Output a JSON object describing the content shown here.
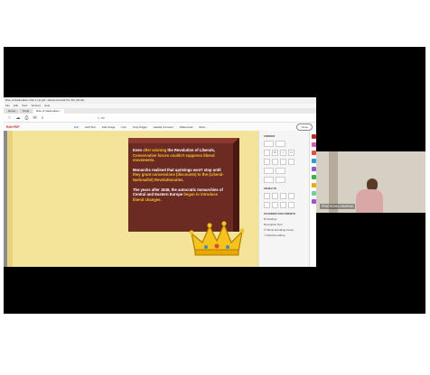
{
  "window": {
    "title": "Rise of Nationalism Part 1 (1).pdf - Adobe Acrobat Pro DC (32-bit)"
  },
  "menubar": [
    "File",
    "Edit",
    "View",
    "Window",
    "Help"
  ],
  "tabs": [
    {
      "label": "Home"
    },
    {
      "label": "Tools"
    },
    {
      "label": "Rise of Nationalism..."
    }
  ],
  "toolbar": {
    "page_display": "1 / 55",
    "zoom": "100%"
  },
  "edit_toolbar": {
    "mode_label": "Edit PDF",
    "tools": [
      "Edit",
      "Add Text",
      "Add Image",
      "Link",
      "Crop Pages",
      "Header & Footer",
      "Watermark",
      "More"
    ],
    "close_label": "Close"
  },
  "slide": {
    "p1_a": "Even ",
    "p1_b": "after winning",
    "p1_c": " the Revolution of Liberals, ",
    "p1_d": "Conservative forces couldn't suppress liberal movements.",
    "p2_a": "Monarchs realised that uprisings won't stop until ",
    "p2_b": "they grant concessions (discounts) to the (Liberal-Nationalist) Revolutionaries.",
    "p3_a": "The years after 1848, the autocratic monarchies of Central and Eastern Europe ",
    "p3_b": "began to introduce liberal changes."
  },
  "format_panel": {
    "format_heading": "FORMAT",
    "objects_heading": "OBJECTS",
    "scanned_heading": "SCANNED DOCUMENTS",
    "settings_label": "Settings",
    "recognize_label": "Recognize Text",
    "bounding_label": "Show bounding boxes",
    "restrict_label": "Restrict editing"
  },
  "video": {
    "participant_name": "PRATIKSHA SHARMA"
  },
  "colors": {
    "slide_bg": "#f4e49a",
    "box_brown": "#6b2a22",
    "highlight_yellow": "#f4c430",
    "acrobat_red": "#c12a2a"
  }
}
